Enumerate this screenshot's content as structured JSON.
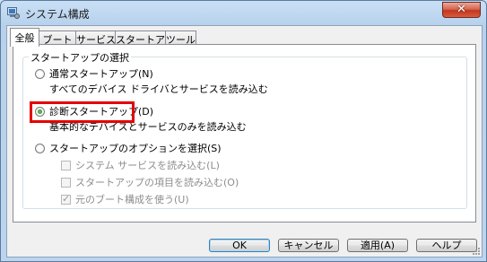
{
  "window": {
    "title": "システム構成",
    "close_glyph": "✕",
    "accent_close": "#c0381f"
  },
  "tabs": [
    {
      "label": "全般",
      "active": true
    },
    {
      "label": "ブート",
      "active": false
    },
    {
      "label": "サービス",
      "active": false
    },
    {
      "label": "スタートアップ",
      "active": false
    },
    {
      "label": "ツール",
      "active": false
    }
  ],
  "group": {
    "title": "スタートアップの選択"
  },
  "options": {
    "normal": {
      "label": "通常スタートアップ(N)",
      "desc": "すべてのデバイス ドライバとサービスを読み込む",
      "checked": false
    },
    "diagnostic": {
      "label": "診断スタートアップ(D)",
      "desc": "基本的なデバイスとサービスのみを読み込む",
      "checked": true
    },
    "selective": {
      "label": "スタートアップのオプションを選択(S)",
      "checked": false
    }
  },
  "checkboxes": [
    {
      "label": "システム サービスを読み込む(L)",
      "checked": false
    },
    {
      "label": "スタートアップの項目を読み込む(O)",
      "checked": false
    },
    {
      "label": "元のブート構成を使う(U)",
      "checked": true
    }
  ],
  "buttons": {
    "ok": "OK",
    "cancel": "キャンセル",
    "apply": "適用(A)",
    "help": "ヘルプ"
  },
  "highlight_color": "#e30000"
}
